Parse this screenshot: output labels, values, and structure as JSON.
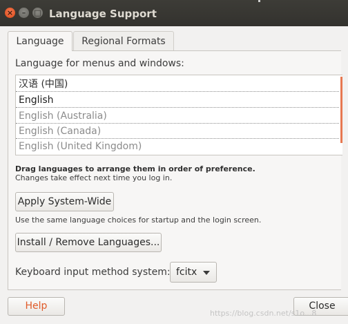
{
  "window": {
    "title": "Language Support"
  },
  "titlebar_buttons": {
    "close_glyph": "×",
    "minimize_glyph": "–",
    "maximize_glyph": "□"
  },
  "tabs": [
    {
      "label": "Language",
      "active": true
    },
    {
      "label": "Regional Formats",
      "active": false
    }
  ],
  "language_tab": {
    "menus_label": "Language for menus and windows:",
    "languages": [
      {
        "label": "汉语 (中国)",
        "enabled": true
      },
      {
        "label": "English",
        "enabled": true
      },
      {
        "label": "English (Australia)",
        "enabled": false
      },
      {
        "label": "English (Canada)",
        "enabled": false
      },
      {
        "label": "English (United Kingdom)",
        "enabled": false
      }
    ],
    "drag_hint": "Drag languages to arrange them in order of preference.",
    "changes_hint": "Changes take effect next time you log in.",
    "apply_button": "Apply System-Wide",
    "apply_note": "Use the same language choices for startup and the login screen.",
    "install_button": "Install / Remove Languages...",
    "keyboard_label": "Keyboard input method system:",
    "keyboard_value": "fcitx"
  },
  "footer": {
    "help_button": "Help",
    "close_button": "Close"
  },
  "watermark": "https://blog.csdn.net/s1o...8",
  "colors": {
    "titlebar": "#3d3c37",
    "close_button": "#dd4814",
    "accent": "#e77850",
    "help_text": "#e05a28"
  }
}
